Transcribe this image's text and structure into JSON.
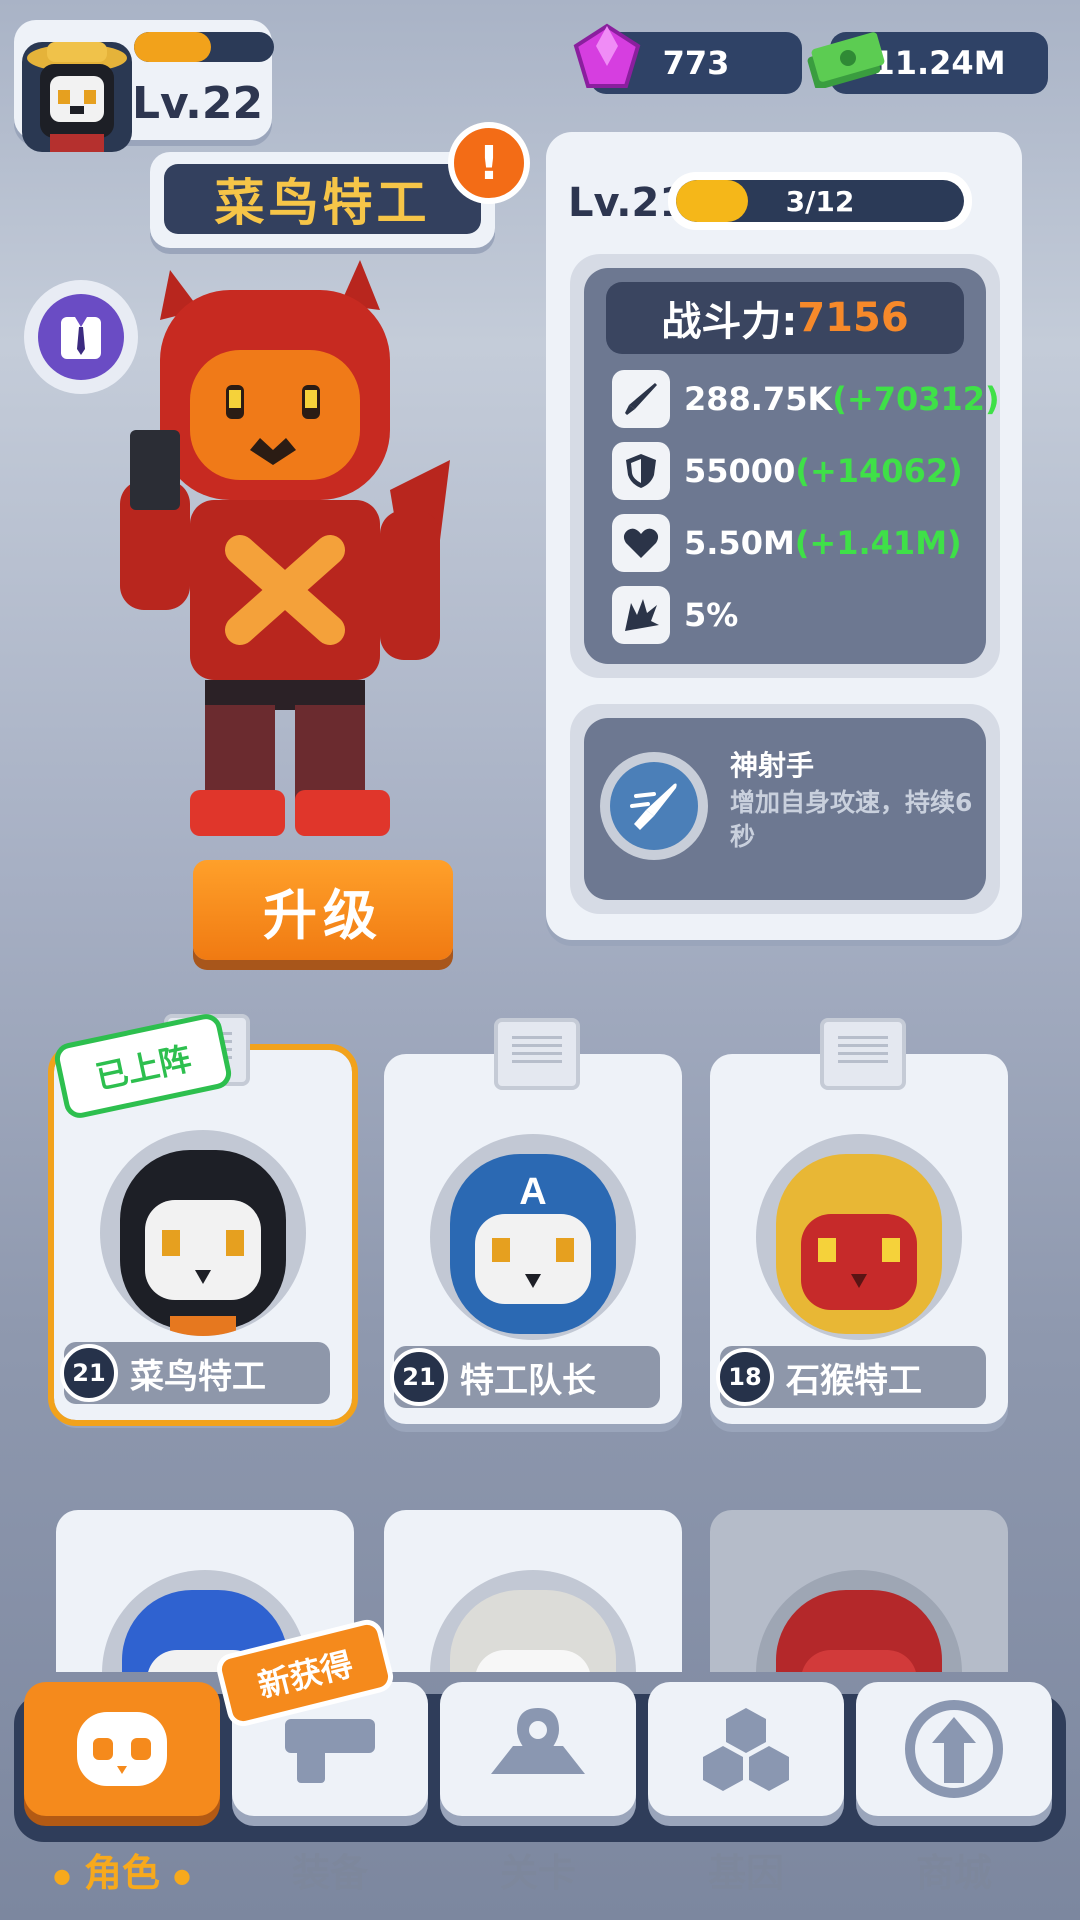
{
  "player": {
    "level": "Lv.22",
    "xp_fraction": 0.55
  },
  "currency": {
    "gems": "773",
    "cash": "11.24M"
  },
  "hero": {
    "name": "菜鸟特工",
    "alert": "!",
    "upgrade_label": "升级"
  },
  "stats_panel": {
    "level": "Lv.21",
    "progress_text": "3/12",
    "progress_fraction": 0.25,
    "power_label": "战斗力:",
    "power_value": "7156",
    "stats": [
      {
        "icon": "attack-icon",
        "value": "288.75K",
        "bonus": "(+70312)"
      },
      {
        "icon": "defense-icon",
        "value": "55000",
        "bonus": "(+14062)"
      },
      {
        "icon": "health-icon",
        "value": "5.50M",
        "bonus": "(+1.41M)"
      },
      {
        "icon": "crit-icon",
        "value": "5%",
        "bonus": ""
      }
    ],
    "skill": {
      "name": "神射手",
      "desc": "增加自身攻速，持续6秒"
    }
  },
  "cards": [
    {
      "level": "21",
      "name": "菜鸟特工",
      "selected": true,
      "tag": "已上阵"
    },
    {
      "level": "21",
      "name": "特工队长",
      "selected": false
    },
    {
      "level": "18",
      "name": "石猴特工",
      "selected": false
    }
  ],
  "new_tag": "新获得",
  "nav": [
    {
      "label": "角色",
      "icon": "character-icon",
      "active": true
    },
    {
      "label": "装备",
      "icon": "equipment-icon",
      "active": false
    },
    {
      "label": "关卡",
      "icon": "stage-map-icon",
      "active": false
    },
    {
      "label": "基因",
      "icon": "gene-icon",
      "active": false
    },
    {
      "label": "商城",
      "icon": "shop-icon",
      "active": false
    }
  ],
  "colors": {
    "accent": "#f58a1c",
    "panel": "#6d7891",
    "bonus": "#3fe048",
    "power": "#f6892a"
  }
}
